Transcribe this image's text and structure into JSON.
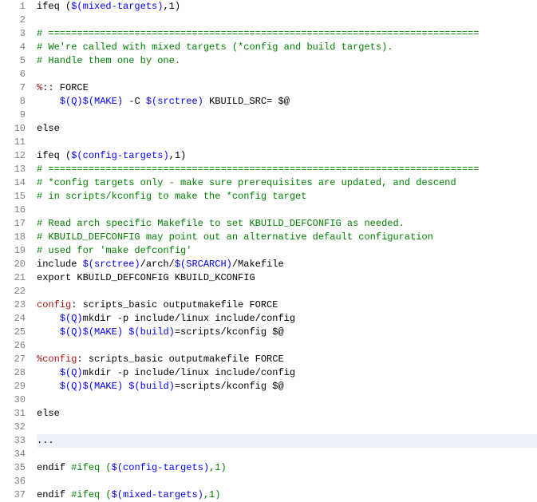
{
  "gutter": {
    "start": 1,
    "end": 37
  },
  "lines": [
    {
      "highlight": false,
      "spans": [
        {
          "t": "ifeq (",
          "c": "c-black"
        },
        {
          "t": "$(mixed-targets)",
          "c": "c-blue"
        },
        {
          "t": ",1)",
          "c": "c-black"
        }
      ]
    },
    {
      "highlight": false,
      "spans": []
    },
    {
      "highlight": false,
      "spans": [
        {
          "t": "# ===========================================================================",
          "c": "c-green"
        }
      ]
    },
    {
      "highlight": false,
      "spans": [
        {
          "t": "# We're called with mixed targets (*config and build targets).",
          "c": "c-green"
        }
      ]
    },
    {
      "highlight": false,
      "spans": [
        {
          "t": "# Handle them one by one.",
          "c": "c-green"
        }
      ]
    },
    {
      "highlight": false,
      "spans": []
    },
    {
      "highlight": false,
      "spans": [
        {
          "t": "%",
          "c": "c-red"
        },
        {
          "t": ":: FORCE",
          "c": "c-black"
        }
      ]
    },
    {
      "highlight": false,
      "spans": [
        {
          "t": "    ",
          "c": "c-black"
        },
        {
          "t": "$(Q)",
          "c": "c-blue"
        },
        {
          "t": "$(MAKE)",
          "c": "c-blue"
        },
        {
          "t": " -C ",
          "c": "c-black"
        },
        {
          "t": "$(srctree)",
          "c": "c-blue"
        },
        {
          "t": " KBUILD_SRC= $@",
          "c": "c-black"
        }
      ]
    },
    {
      "highlight": false,
      "spans": []
    },
    {
      "highlight": false,
      "spans": [
        {
          "t": "else",
          "c": "c-black"
        }
      ]
    },
    {
      "highlight": false,
      "spans": []
    },
    {
      "highlight": false,
      "spans": [
        {
          "t": "ifeq (",
          "c": "c-black"
        },
        {
          "t": "$(config-targets)",
          "c": "c-blue"
        },
        {
          "t": ",1)",
          "c": "c-black"
        }
      ]
    },
    {
      "highlight": false,
      "spans": [
        {
          "t": "# ===========================================================================",
          "c": "c-green"
        }
      ]
    },
    {
      "highlight": false,
      "spans": [
        {
          "t": "# *config targets only - make sure prerequisites are updated, and descend",
          "c": "c-green"
        }
      ]
    },
    {
      "highlight": false,
      "spans": [
        {
          "t": "# in scripts/kconfig to make the *config target",
          "c": "c-green"
        }
      ]
    },
    {
      "highlight": false,
      "spans": []
    },
    {
      "highlight": false,
      "spans": [
        {
          "t": "# Read arch specific Makefile to set KBUILD_DEFCONFIG as needed.",
          "c": "c-green"
        }
      ]
    },
    {
      "highlight": false,
      "spans": [
        {
          "t": "# KBUILD_DEFCONFIG may point out an alternative default configuration",
          "c": "c-green"
        }
      ]
    },
    {
      "highlight": false,
      "spans": [
        {
          "t": "# used for 'make defconfig'",
          "c": "c-green"
        }
      ]
    },
    {
      "highlight": false,
      "spans": [
        {
          "t": "include ",
          "c": "c-black"
        },
        {
          "t": "$(srctree)",
          "c": "c-blue"
        },
        {
          "t": "/arch/",
          "c": "c-black"
        },
        {
          "t": "$(SRCARCH)",
          "c": "c-blue"
        },
        {
          "t": "/Makefile",
          "c": "c-black"
        }
      ]
    },
    {
      "highlight": false,
      "spans": [
        {
          "t": "export KBUILD_DEFCONFIG KBUILD_KCONFIG",
          "c": "c-black"
        }
      ]
    },
    {
      "highlight": false,
      "spans": []
    },
    {
      "highlight": false,
      "spans": [
        {
          "t": "config",
          "c": "c-red"
        },
        {
          "t": ": scripts_basic outputmakefile FORCE",
          "c": "c-black"
        }
      ]
    },
    {
      "highlight": false,
      "spans": [
        {
          "t": "    ",
          "c": "c-black"
        },
        {
          "t": "$(Q)",
          "c": "c-blue"
        },
        {
          "t": "mkdir -p include/linux include/config",
          "c": "c-black"
        }
      ]
    },
    {
      "highlight": false,
      "spans": [
        {
          "t": "    ",
          "c": "c-black"
        },
        {
          "t": "$(Q)",
          "c": "c-blue"
        },
        {
          "t": "$(MAKE)",
          "c": "c-blue"
        },
        {
          "t": " ",
          "c": "c-black"
        },
        {
          "t": "$(build)",
          "c": "c-blue"
        },
        {
          "t": "=scripts/kconfig $@",
          "c": "c-black"
        }
      ]
    },
    {
      "highlight": false,
      "spans": []
    },
    {
      "highlight": false,
      "spans": [
        {
          "t": "%config",
          "c": "c-red"
        },
        {
          "t": ": scripts_basic outputmakefile FORCE",
          "c": "c-black"
        }
      ]
    },
    {
      "highlight": false,
      "spans": [
        {
          "t": "    ",
          "c": "c-black"
        },
        {
          "t": "$(Q)",
          "c": "c-blue"
        },
        {
          "t": "mkdir -p include/linux include/config",
          "c": "c-black"
        }
      ]
    },
    {
      "highlight": false,
      "spans": [
        {
          "t": "    ",
          "c": "c-black"
        },
        {
          "t": "$(Q)",
          "c": "c-blue"
        },
        {
          "t": "$(MAKE)",
          "c": "c-blue"
        },
        {
          "t": " ",
          "c": "c-black"
        },
        {
          "t": "$(build)",
          "c": "c-blue"
        },
        {
          "t": "=scripts/kconfig $@",
          "c": "c-black"
        }
      ]
    },
    {
      "highlight": false,
      "spans": []
    },
    {
      "highlight": false,
      "spans": [
        {
          "t": "else",
          "c": "c-black"
        }
      ]
    },
    {
      "highlight": false,
      "spans": []
    },
    {
      "highlight": true,
      "spans": [
        {
          "t": "...",
          "c": "c-black"
        }
      ]
    },
    {
      "highlight": false,
      "spans": []
    },
    {
      "highlight": false,
      "spans": [
        {
          "t": "endif ",
          "c": "c-black"
        },
        {
          "t": "#ifeq (",
          "c": "c-green"
        },
        {
          "t": "$(config-targets)",
          "c": "c-blue"
        },
        {
          "t": ",1)",
          "c": "c-green"
        }
      ]
    },
    {
      "highlight": false,
      "spans": []
    },
    {
      "highlight": false,
      "spans": [
        {
          "t": "endif ",
          "c": "c-black"
        },
        {
          "t": "#ifeq (",
          "c": "c-green"
        },
        {
          "t": "$(mixed-targets)",
          "c": "c-blue"
        },
        {
          "t": ",1)",
          "c": "c-green"
        }
      ]
    }
  ]
}
